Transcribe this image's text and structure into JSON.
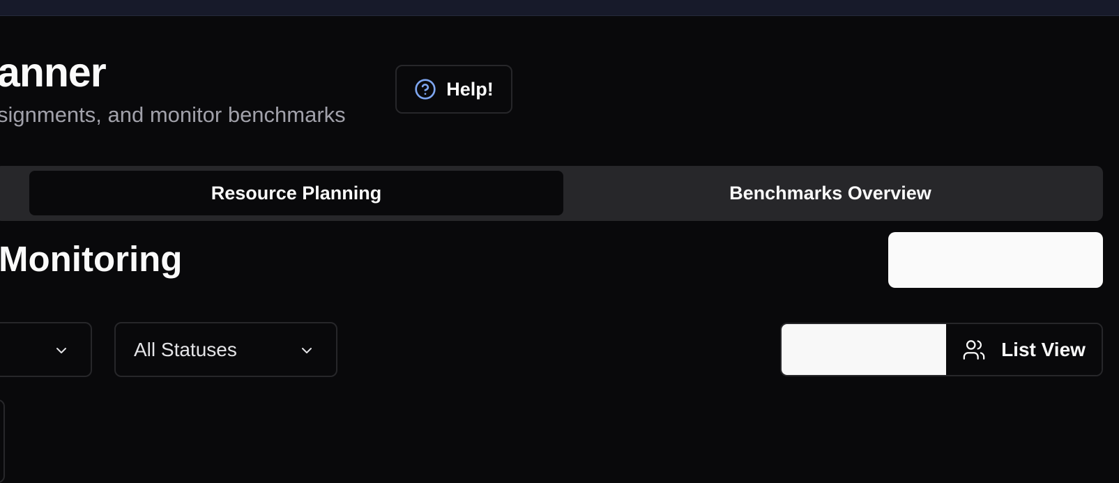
{
  "header": {
    "title": "anner",
    "subtitle": "signments, and monitor benchmarks",
    "help_label": "Help!"
  },
  "tabs": [
    {
      "label": "Resource Planning",
      "active": true
    },
    {
      "label": "Benchmarks Overview",
      "active": false
    }
  ],
  "section": {
    "title": "Monitoring"
  },
  "filters": {
    "status_value": "All Statuses"
  },
  "view_toggle": {
    "list_label": "List View"
  },
  "icons": {
    "help": "help-circle-icon",
    "chevron": "chevron-down-icon",
    "list_view": "users-icon"
  },
  "colors": {
    "background": "#09090b",
    "topbar": "#171a2a",
    "tab_track": "#27272a",
    "border": "#27272a",
    "text_primary": "#fafafa",
    "text_muted": "#a1a1aa",
    "help_icon_accent": "#7ea6f0",
    "primary_button": "#fafafa"
  }
}
